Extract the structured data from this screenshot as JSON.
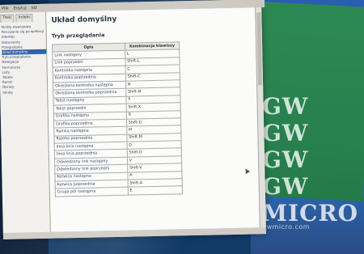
{
  "menu": {
    "items": [
      "Plik",
      "Edytuj",
      "Idź"
    ]
  },
  "sidebar": {
    "tabs": [
      "Treść",
      "Indeks"
    ],
    "items": [
      "Skróty klawiszowe",
      "Poruszanie się po aplikacji",
      "Interfejs",
      "Dokumenty",
      "Przeglądanie",
      "Układ domyślny",
      "Tryb przeglądania",
      "Nawigacja",
      "Formularze",
      "Listy",
      "Tabele",
      "Ramki",
      "Obrazy",
      "Skróty"
    ],
    "selected_index": 5
  },
  "content": {
    "title": "Układ domyślny",
    "subtitle": "Tryb przeglądania",
    "table": {
      "headers": [
        "Opis",
        "Kombinacja klawiszy"
      ],
      "rows": [
        [
          "Link następny",
          "L"
        ],
        [
          "Link poprzedni",
          "Shift-L"
        ],
        [
          "Kontrolka następna",
          "C"
        ],
        [
          "Kontrolka poprzednia",
          "Shift-C"
        ],
        [
          "Określona kontrolka następna",
          "N"
        ],
        [
          "Określona kontrolka poprzednia",
          "Shift-N"
        ],
        [
          "Tekst następny",
          "X"
        ],
        [
          "Tekst poprzedni",
          "Shift-X"
        ],
        [
          "Grafika następna",
          "G"
        ],
        [
          "Grafika poprzednia",
          "Shift-G"
        ],
        [
          "Ramka następna",
          "M"
        ],
        [
          "Ramka poprzednia",
          "Shift-M"
        ],
        [
          "Inna linia następna",
          "D"
        ],
        [
          "Inna linia poprzednia",
          "Shift-D"
        ],
        [
          "Odwiedzony link następny",
          "V"
        ],
        [
          "Odwiedzony link poprzedni",
          "Shift-V"
        ],
        [
          "Kotwica następna",
          "A"
        ],
        [
          "Kotwica poprzednia",
          "Shift-A"
        ],
        [
          "Grupa pól następna",
          "E"
        ]
      ]
    }
  },
  "watermark": {
    "lines": [
      "GW",
      "GW",
      "GW",
      "GW",
      "MICRO"
    ],
    "sub": "gwmicro.com"
  },
  "colors": {
    "selected": "#2d5fa8",
    "header_bg": "#e8e7e2",
    "content_bg": "#fbfbf9",
    "green_panel": "#2d8b4e"
  }
}
